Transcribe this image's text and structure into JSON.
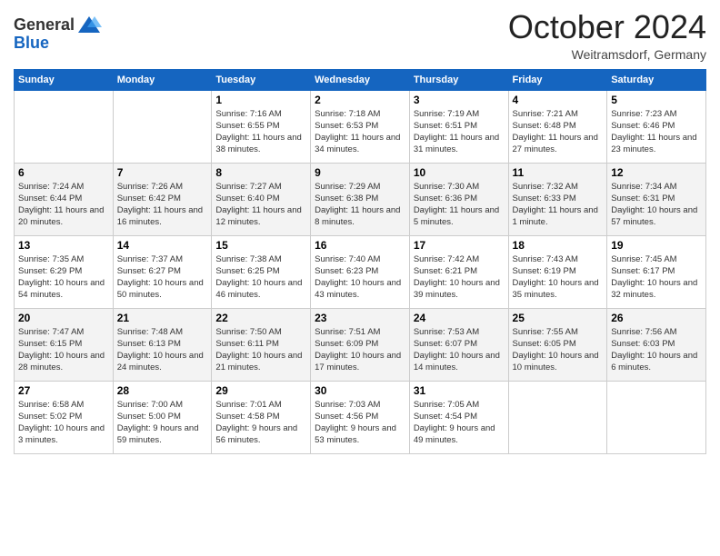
{
  "header": {
    "logo_general": "General",
    "logo_blue": "Blue",
    "month_title": "October 2024",
    "location": "Weitramsdorf, Germany"
  },
  "weekdays": [
    "Sunday",
    "Monday",
    "Tuesday",
    "Wednesday",
    "Thursday",
    "Friday",
    "Saturday"
  ],
  "weeks": [
    [
      {
        "day": "",
        "info": ""
      },
      {
        "day": "",
        "info": ""
      },
      {
        "day": "1",
        "sunrise": "Sunrise: 7:16 AM",
        "sunset": "Sunset: 6:55 PM",
        "daylight": "Daylight: 11 hours and 38 minutes."
      },
      {
        "day": "2",
        "sunrise": "Sunrise: 7:18 AM",
        "sunset": "Sunset: 6:53 PM",
        "daylight": "Daylight: 11 hours and 34 minutes."
      },
      {
        "day": "3",
        "sunrise": "Sunrise: 7:19 AM",
        "sunset": "Sunset: 6:51 PM",
        "daylight": "Daylight: 11 hours and 31 minutes."
      },
      {
        "day": "4",
        "sunrise": "Sunrise: 7:21 AM",
        "sunset": "Sunset: 6:48 PM",
        "daylight": "Daylight: 11 hours and 27 minutes."
      },
      {
        "day": "5",
        "sunrise": "Sunrise: 7:23 AM",
        "sunset": "Sunset: 6:46 PM",
        "daylight": "Daylight: 11 hours and 23 minutes."
      }
    ],
    [
      {
        "day": "6",
        "sunrise": "Sunrise: 7:24 AM",
        "sunset": "Sunset: 6:44 PM",
        "daylight": "Daylight: 11 hours and 20 minutes."
      },
      {
        "day": "7",
        "sunrise": "Sunrise: 7:26 AM",
        "sunset": "Sunset: 6:42 PM",
        "daylight": "Daylight: 11 hours and 16 minutes."
      },
      {
        "day": "8",
        "sunrise": "Sunrise: 7:27 AM",
        "sunset": "Sunset: 6:40 PM",
        "daylight": "Daylight: 11 hours and 12 minutes."
      },
      {
        "day": "9",
        "sunrise": "Sunrise: 7:29 AM",
        "sunset": "Sunset: 6:38 PM",
        "daylight": "Daylight: 11 hours and 8 minutes."
      },
      {
        "day": "10",
        "sunrise": "Sunrise: 7:30 AM",
        "sunset": "Sunset: 6:36 PM",
        "daylight": "Daylight: 11 hours and 5 minutes."
      },
      {
        "day": "11",
        "sunrise": "Sunrise: 7:32 AM",
        "sunset": "Sunset: 6:33 PM",
        "daylight": "Daylight: 11 hours and 1 minute."
      },
      {
        "day": "12",
        "sunrise": "Sunrise: 7:34 AM",
        "sunset": "Sunset: 6:31 PM",
        "daylight": "Daylight: 10 hours and 57 minutes."
      }
    ],
    [
      {
        "day": "13",
        "sunrise": "Sunrise: 7:35 AM",
        "sunset": "Sunset: 6:29 PM",
        "daylight": "Daylight: 10 hours and 54 minutes."
      },
      {
        "day": "14",
        "sunrise": "Sunrise: 7:37 AM",
        "sunset": "Sunset: 6:27 PM",
        "daylight": "Daylight: 10 hours and 50 minutes."
      },
      {
        "day": "15",
        "sunrise": "Sunrise: 7:38 AM",
        "sunset": "Sunset: 6:25 PM",
        "daylight": "Daylight: 10 hours and 46 minutes."
      },
      {
        "day": "16",
        "sunrise": "Sunrise: 7:40 AM",
        "sunset": "Sunset: 6:23 PM",
        "daylight": "Daylight: 10 hours and 43 minutes."
      },
      {
        "day": "17",
        "sunrise": "Sunrise: 7:42 AM",
        "sunset": "Sunset: 6:21 PM",
        "daylight": "Daylight: 10 hours and 39 minutes."
      },
      {
        "day": "18",
        "sunrise": "Sunrise: 7:43 AM",
        "sunset": "Sunset: 6:19 PM",
        "daylight": "Daylight: 10 hours and 35 minutes."
      },
      {
        "day": "19",
        "sunrise": "Sunrise: 7:45 AM",
        "sunset": "Sunset: 6:17 PM",
        "daylight": "Daylight: 10 hours and 32 minutes."
      }
    ],
    [
      {
        "day": "20",
        "sunrise": "Sunrise: 7:47 AM",
        "sunset": "Sunset: 6:15 PM",
        "daylight": "Daylight: 10 hours and 28 minutes."
      },
      {
        "day": "21",
        "sunrise": "Sunrise: 7:48 AM",
        "sunset": "Sunset: 6:13 PM",
        "daylight": "Daylight: 10 hours and 24 minutes."
      },
      {
        "day": "22",
        "sunrise": "Sunrise: 7:50 AM",
        "sunset": "Sunset: 6:11 PM",
        "daylight": "Daylight: 10 hours and 21 minutes."
      },
      {
        "day": "23",
        "sunrise": "Sunrise: 7:51 AM",
        "sunset": "Sunset: 6:09 PM",
        "daylight": "Daylight: 10 hours and 17 minutes."
      },
      {
        "day": "24",
        "sunrise": "Sunrise: 7:53 AM",
        "sunset": "Sunset: 6:07 PM",
        "daylight": "Daylight: 10 hours and 14 minutes."
      },
      {
        "day": "25",
        "sunrise": "Sunrise: 7:55 AM",
        "sunset": "Sunset: 6:05 PM",
        "daylight": "Daylight: 10 hours and 10 minutes."
      },
      {
        "day": "26",
        "sunrise": "Sunrise: 7:56 AM",
        "sunset": "Sunset: 6:03 PM",
        "daylight": "Daylight: 10 hours and 6 minutes."
      }
    ],
    [
      {
        "day": "27",
        "sunrise": "Sunrise: 6:58 AM",
        "sunset": "Sunset: 5:02 PM",
        "daylight": "Daylight: 10 hours and 3 minutes."
      },
      {
        "day": "28",
        "sunrise": "Sunrise: 7:00 AM",
        "sunset": "Sunset: 5:00 PM",
        "daylight": "Daylight: 9 hours and 59 minutes."
      },
      {
        "day": "29",
        "sunrise": "Sunrise: 7:01 AM",
        "sunset": "Sunset: 4:58 PM",
        "daylight": "Daylight: 9 hours and 56 minutes."
      },
      {
        "day": "30",
        "sunrise": "Sunrise: 7:03 AM",
        "sunset": "Sunset: 4:56 PM",
        "daylight": "Daylight: 9 hours and 53 minutes."
      },
      {
        "day": "31",
        "sunrise": "Sunrise: 7:05 AM",
        "sunset": "Sunset: 4:54 PM",
        "daylight": "Daylight: 9 hours and 49 minutes."
      },
      {
        "day": "",
        "info": ""
      },
      {
        "day": "",
        "info": ""
      }
    ]
  ]
}
